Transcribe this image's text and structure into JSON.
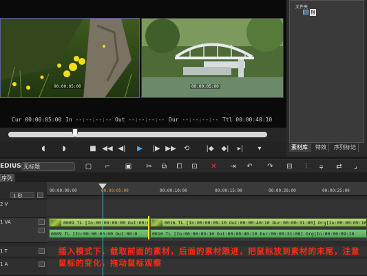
{
  "preview": {
    "left_overlay_tc": "00:00:05:00",
    "right_overlay_tc": "00:00:05:00",
    "timecodes": {
      "cur": "Cur 00:00:05:00",
      "in": "In --:--:--:--",
      "out": "Out --:--:--:--",
      "dur": "Dur --:--:--:--",
      "ttl": "Ttl 00:00:40:10"
    }
  },
  "bin": {
    "title": "文件夹",
    "folder_label": "根",
    "tabs": [
      "素材库",
      "特效",
      "序列标记"
    ]
  },
  "toolbar": {
    "app_name": "EDIUS",
    "project_name": "无标题"
  },
  "sequence": {
    "tab_label": "序列1"
  },
  "tracks": {
    "scale_label": "1 秒",
    "v2_label": "2 V",
    "va1_label": "1 VA",
    "t1_label": "1 T",
    "a1_label": "1 A"
  },
  "ruler": {
    "ticks": [
      "00:00:00:00",
      "00:00:05:00",
      "00:00:10:00",
      "00:00:15:00",
      "00:00:20:00",
      "00:00:25:00"
    ]
  },
  "clips": {
    "video_a": "0009  TL [In:00:00:00:00 Out:00:0",
    "video_b": "0016  TL [In:00:00:09:10 Out:00:00:40:10 Dur:00:00:31:00]  Org[In:00:00:09:10",
    "audio_a": "0009  TL [In:00:00:00:00 Out:00:0",
    "audio_b": "0016  TL [In:00:00:09:10 Out:00:00:40:10 Dur:00:00:31:00]  Org[In:00:00:09:10"
  },
  "annotation": "插入模式下，截取前面的素材，后面的素材跟进，把鼠标放到素材的末尾，注意鼠标的变化，拖动鼠标观察"
}
